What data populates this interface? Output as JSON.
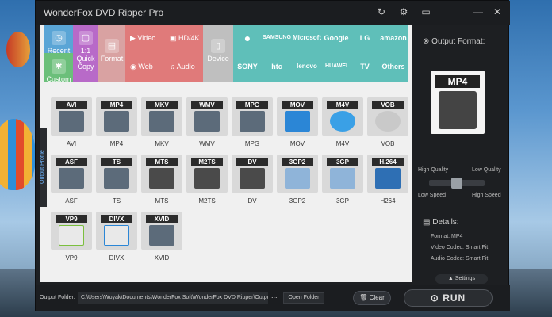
{
  "window": {
    "title": "WonderFox DVD Ripper Pro"
  },
  "titlebar_icons": [
    "refresh-icon",
    "settings-icon",
    "chat-icon",
    "minimize-icon",
    "close-icon"
  ],
  "categories": {
    "recent": "Recent",
    "custom": "Custom",
    "quick_copy": "1:1\nQuick\nCopy",
    "format": "Format",
    "video": "Video",
    "hd4k": "HD/4K",
    "web": "Web",
    "audio": "Audio",
    "device": "Device"
  },
  "brands_row1": [
    "",
    "SAMSUNG",
    "Microsoft",
    "Google",
    "LG",
    "amazon"
  ],
  "brands_row2": [
    "SONY",
    "htc",
    "lenovo",
    "HUAWEI",
    "TV",
    "Others"
  ],
  "side_tab": "Output Profile",
  "formats": [
    {
      "code": "AVI",
      "label": "AVI"
    },
    {
      "code": "MP4",
      "label": "MP4"
    },
    {
      "code": "MKV",
      "label": "MKV"
    },
    {
      "code": "WMV",
      "label": "WMV"
    },
    {
      "code": "MPG",
      "label": "MPG"
    },
    {
      "code": "MOV",
      "label": "MOV"
    },
    {
      "code": "M4V",
      "label": "M4V"
    },
    {
      "code": "VOB",
      "label": "VOB"
    },
    {
      "code": "ASF",
      "label": "ASF"
    },
    {
      "code": "TS",
      "label": "TS"
    },
    {
      "code": "MTS",
      "label": "MTS"
    },
    {
      "code": "M2TS",
      "label": "M2TS"
    },
    {
      "code": "DV",
      "label": "DV"
    },
    {
      "code": "3GP2",
      "label": "3GP2"
    },
    {
      "code": "3GP",
      "label": "3GP"
    },
    {
      "code": "H.264",
      "label": "H264"
    },
    {
      "code": "VP9",
      "label": "VP9"
    },
    {
      "code": "DIVX",
      "label": "DIVX"
    },
    {
      "code": "XVID",
      "label": "XVID"
    }
  ],
  "output": {
    "title": "Output Format:",
    "selected": "MP4",
    "high_quality": "High Quality",
    "low_quality": "Low Quality",
    "low_speed": "Low Speed",
    "high_speed": "High Speed",
    "details_title": "Details:",
    "format_line": "Format: MP4",
    "video_codec": "Video Codec: Smart Fit",
    "audio_codec": "Audio Codec: Smart Fit",
    "settings": "Settings"
  },
  "bottom": {
    "folder_label": "Output Folder:",
    "folder_path": "C:\\Users\\Woyak\\Documents\\WonderFox Soft\\WonderFox DVD Ripper\\OutputVide",
    "dots": "...",
    "open_folder": "Open Folder",
    "clear": "Clear",
    "run": "RUN"
  },
  "colors": {
    "recent_bg": "#5aa5d6",
    "custom_bg": "#6bbf7a",
    "quick_bg": "#b86ac8",
    "format_bg": "#d9a2a2",
    "video_bg": "#e07a7a",
    "device_bg": "#bfbfbf",
    "brand_bg": "#5fbfb9"
  }
}
